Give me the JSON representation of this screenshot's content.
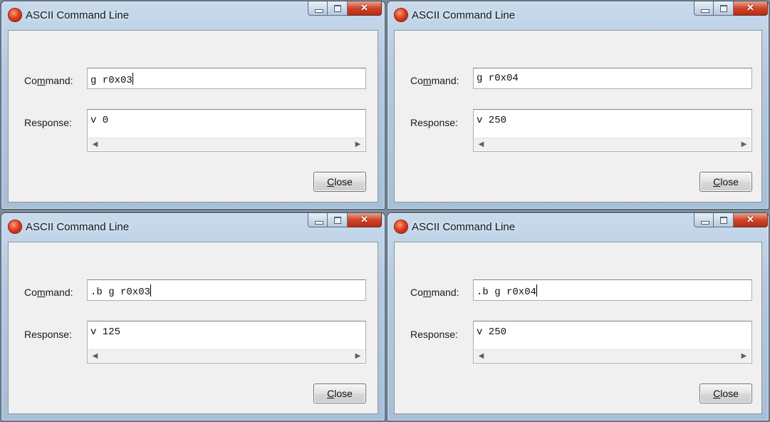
{
  "windows": [
    {
      "title": "ASCII Command Line",
      "command_label_pre": "Co",
      "command_label_hotkey": "m",
      "command_label_post": "mand:",
      "response_label": "Response:",
      "command_value": "g r0x03",
      "response_value": "v 0",
      "close_hotkey": "C",
      "close_rest": "lose"
    },
    {
      "title": "ASCII Command Line",
      "command_label_pre": "Co",
      "command_label_hotkey": "m",
      "command_label_post": "mand:",
      "response_label": "Response:",
      "command_value": "g r0x04",
      "response_value": "v 250",
      "close_hotkey": "C",
      "close_rest": "lose"
    },
    {
      "title": "ASCII Command Line",
      "command_label_pre": "Co",
      "command_label_hotkey": "m",
      "command_label_post": "mand:",
      "response_label": "Response:",
      "command_value": ".b g r0x03",
      "response_value": "v 125",
      "close_hotkey": "C",
      "close_rest": "lose"
    },
    {
      "title": "ASCII Command Line",
      "command_label_pre": "Co",
      "command_label_hotkey": "m",
      "command_label_post": "mand:",
      "response_label": "Response:",
      "command_value": ".b g r0x04",
      "response_value": "v 250",
      "close_hotkey": "C",
      "close_rest": "lose"
    }
  ],
  "icons": {
    "app": "app-icon",
    "minimize": "minimize-icon",
    "maximize": "maximize-icon",
    "close": "close-icon",
    "scroll_left": "scroll-left-arrow-icon",
    "scroll_right": "scroll-right-arrow-icon"
  },
  "colors": {
    "title_bar": "#b3c9df",
    "close_button": "#d0442a",
    "client_background": "#f0f0f0"
  }
}
